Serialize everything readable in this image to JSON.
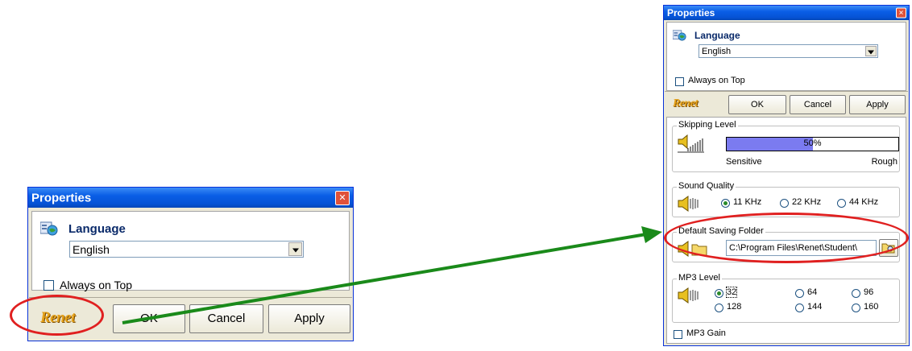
{
  "small_dialog": {
    "title": "Properties",
    "close_glyph": "✕",
    "language_label": "Language",
    "language_value": "English",
    "always_on_top_label": "Always on Top",
    "logo_text": "Renet",
    "ok_label": "OK",
    "cancel_label": "Cancel",
    "apply_label": "Apply"
  },
  "large_dialog": {
    "title": "Properties",
    "close_glyph": "✕",
    "language_label": "Language",
    "language_value": "English",
    "always_on_top_label": "Always on Top",
    "logo_text": "Renet",
    "ok_label": "OK",
    "cancel_label": "Cancel",
    "apply_label": "Apply",
    "skipping": {
      "title": "Skipping Level",
      "percent_text": "50%",
      "level": 0.5,
      "left_label": "Sensitive",
      "right_label": "Rough"
    },
    "sound_quality": {
      "title": "Sound Quality",
      "options": [
        "11 KHz",
        "22 KHz",
        "44 KHz"
      ],
      "selected": "11 KHz"
    },
    "saving_folder": {
      "title": "Default Saving Folder",
      "path": "C:\\Program Files\\Renet\\Student\\"
    },
    "mp3_level": {
      "title": "MP3 Level",
      "options": [
        "32",
        "64",
        "96",
        "128",
        "144",
        "160"
      ],
      "selected": "32"
    },
    "mp3_gain_label": "MP3 Gain"
  },
  "colors": {
    "titlebar": "#0a5ee6",
    "annotation_ellipse": "#e02020",
    "annotation_arrow": "#1a8a1a",
    "progress_fill": "#7b7bf0"
  }
}
